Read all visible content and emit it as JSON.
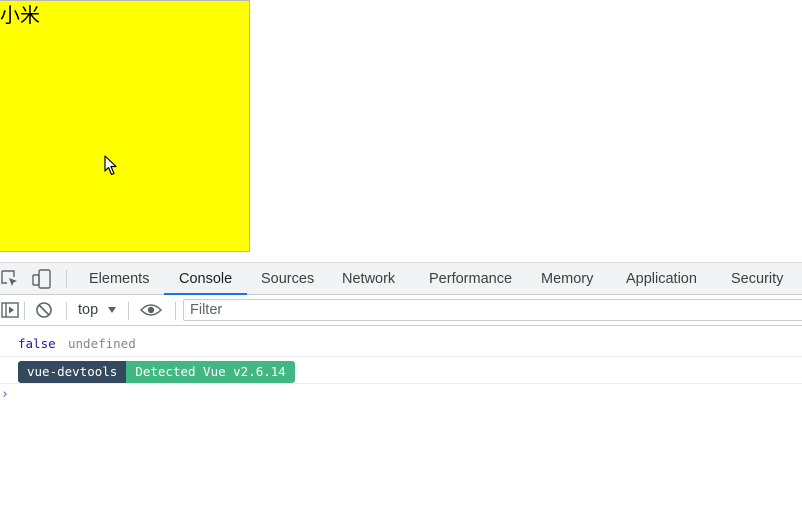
{
  "page": {
    "box_text": "小米",
    "box_color": "#ffff00"
  },
  "devtools": {
    "tabs": [
      {
        "label": "Elements"
      },
      {
        "label": "Console"
      },
      {
        "label": "Sources"
      },
      {
        "label": "Network"
      },
      {
        "label": "Performance"
      },
      {
        "label": "Memory"
      },
      {
        "label": "Application"
      },
      {
        "label": "Security"
      }
    ],
    "active_tab": "Console",
    "accent": "#1a73e8",
    "toolbar": {
      "context": "top",
      "filter_placeholder": "Filter"
    },
    "icons": {
      "inspect": "inspect-element-icon",
      "device": "device-toolbar-icon",
      "sidebar": "show-sidebar-icon",
      "clear": "clear-console-icon",
      "eye": "live-expression-icon"
    },
    "console": {
      "line1": {
        "value": "false",
        "result": "undefined"
      },
      "line2": {
        "badge_left": "vue-devtools",
        "badge_right": "Detected Vue v2.6.14"
      },
      "prompt": "›"
    },
    "colors": {
      "vue_dark": "#35495e",
      "vue_green": "#41b883"
    }
  }
}
